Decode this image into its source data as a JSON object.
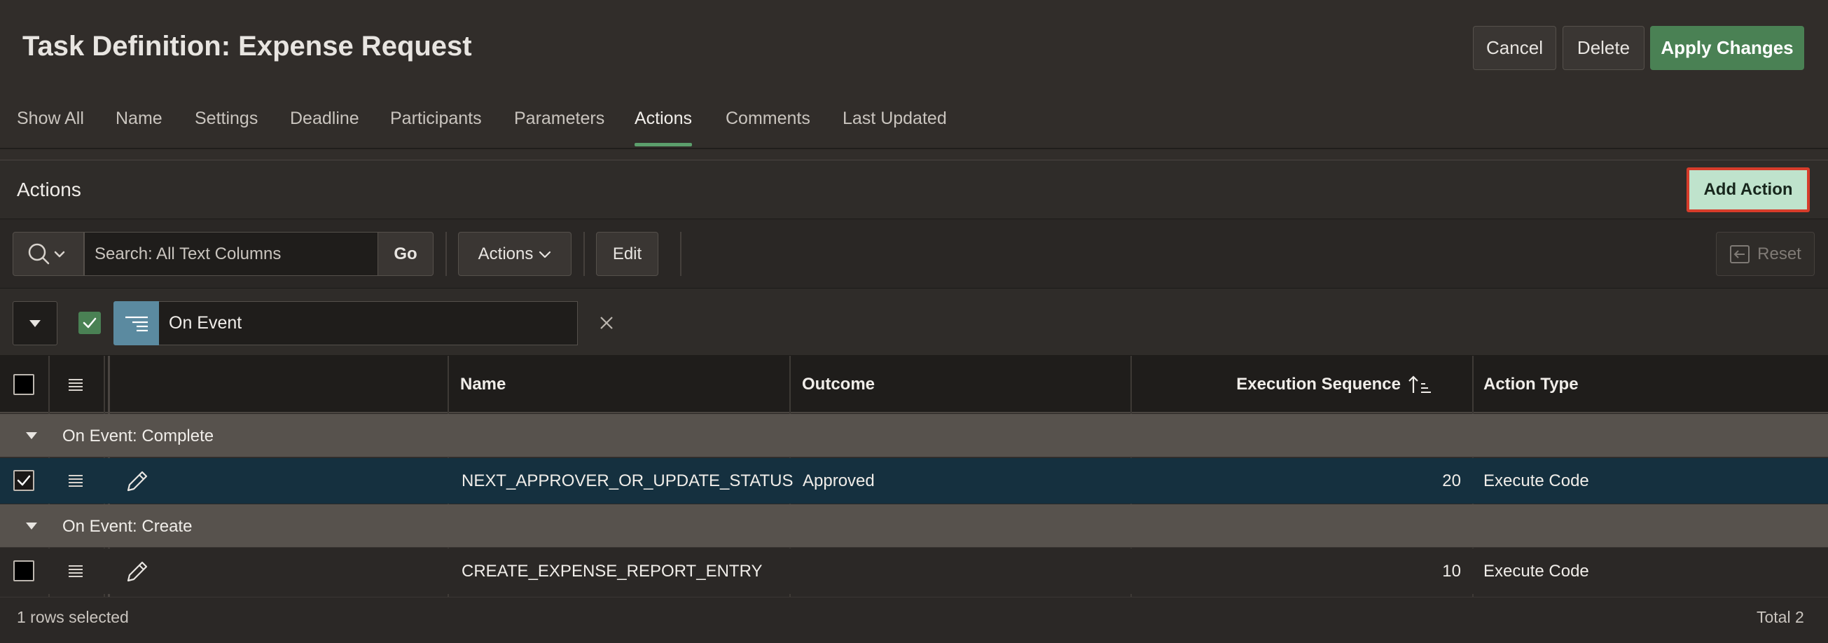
{
  "header": {
    "title": "Task Definition: Expense Request",
    "cancel_label": "Cancel",
    "delete_label": "Delete",
    "apply_label": "Apply Changes"
  },
  "tabs": [
    {
      "label": "Show All"
    },
    {
      "label": "Name"
    },
    {
      "label": "Settings"
    },
    {
      "label": "Deadline"
    },
    {
      "label": "Participants"
    },
    {
      "label": "Parameters"
    },
    {
      "label": "Actions",
      "active": true
    },
    {
      "label": "Comments"
    },
    {
      "label": "Last Updated"
    }
  ],
  "region": {
    "title": "Actions",
    "add_action_label": "Add Action"
  },
  "toolbar": {
    "search_placeholder": "Search: All Text Columns",
    "go_label": "Go",
    "actions_label": "Actions",
    "edit_label": "Edit",
    "reset_label": "Reset"
  },
  "control_break": {
    "label": "On Event",
    "enabled": true
  },
  "grid": {
    "columns": {
      "name": "Name",
      "outcome": "Outcome",
      "execution_sequence": "Execution Sequence",
      "action_type": "Action Type"
    },
    "groups": [
      {
        "label": "On Event: Complete",
        "rows": [
          {
            "name": "NEXT_APPROVER_OR_UPDATE_STATUS",
            "outcome": "Approved",
            "execution_sequence": "20",
            "action_type": "Execute Code",
            "selected": true
          }
        ]
      },
      {
        "label": "On Event: Create",
        "rows": [
          {
            "name": "CREATE_EXPENSE_REPORT_ENTRY",
            "outcome": "",
            "execution_sequence": "10",
            "action_type": "Execute Code",
            "selected": false
          }
        ]
      }
    ]
  },
  "footer": {
    "selection_text": "1 rows selected",
    "total_text": "Total 2"
  },
  "colors": {
    "accent_green": "#4a8154",
    "tab_underline": "#5c9f6c",
    "add_action_bg": "#bfe3cc",
    "add_action_border": "#d63c2a",
    "selected_row": "#15303f",
    "group_row": "#57524d"
  }
}
